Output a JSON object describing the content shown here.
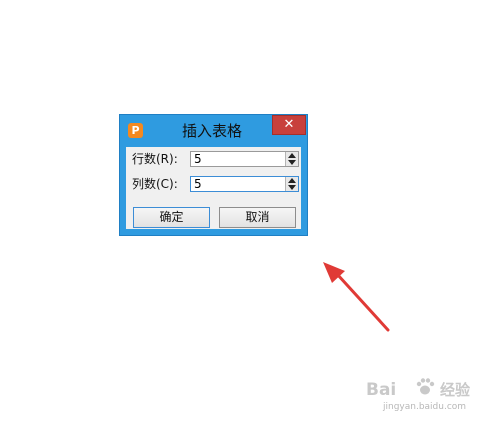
{
  "dialog": {
    "title": "插入表格",
    "app_icon_glyph": "P",
    "close_glyph": "✕",
    "rows_label": "行数(R):",
    "rows_value": "5",
    "cols_label": "列数(C):",
    "cols_value": "5",
    "ok_label": "确定",
    "cancel_label": "取消"
  },
  "watermark": {
    "logo": "Bai",
    "jingyan": "经验",
    "url": "jingyan.baidu.com"
  },
  "colors": {
    "titlebar": "#2f9be0",
    "close": "#c8403c",
    "arrow": "#e03a36",
    "app_icon": "#f5891f"
  },
  "icons": [
    "app-logo-icon",
    "close-icon",
    "spin-up-icon",
    "spin-down-icon",
    "red-pointer-arrow-icon",
    "baidu-paw-icon"
  ]
}
